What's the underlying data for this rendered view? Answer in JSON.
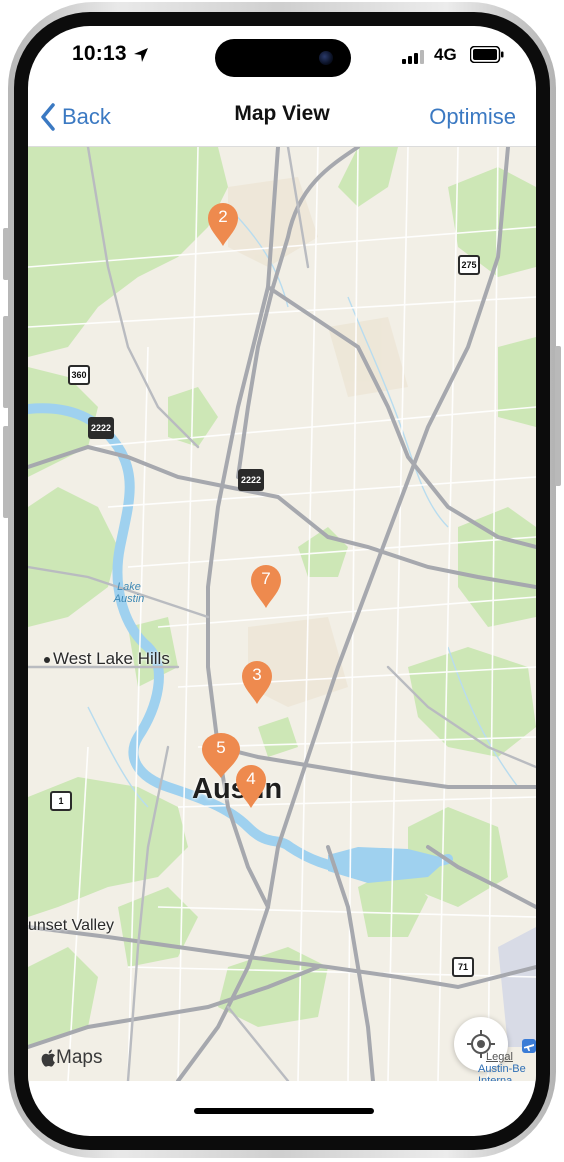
{
  "status_bar": {
    "time": "10:13",
    "network": "4G"
  },
  "nav": {
    "back_label": "Back",
    "title": "Map View",
    "action_label": "Optimise"
  },
  "map": {
    "city_label": "Austin",
    "places": {
      "west_lake_hills": "West Lake Hills",
      "sunset_valley": "unset Valley",
      "lake_austin": "Lake Austin"
    },
    "highway_shields": {
      "h275": "275",
      "h360": "360",
      "h2222_a": "2222",
      "h2222_b": "2222",
      "h1": "1",
      "h71": "71"
    },
    "pins": [
      {
        "label": "2"
      },
      {
        "label": "7"
      },
      {
        "label": "3"
      },
      {
        "label": "5"
      },
      {
        "label": "4"
      }
    ],
    "pin_color": "#ee8a4e",
    "attribution": "Maps",
    "legal_label": "Legal",
    "airport_label": "Austin-Be Interna"
  },
  "colors": {
    "accent": "#3b79c2",
    "map_background": "#f2efe6",
    "park_green": "#cde7b6",
    "water_blue": "#9fd1ef"
  }
}
